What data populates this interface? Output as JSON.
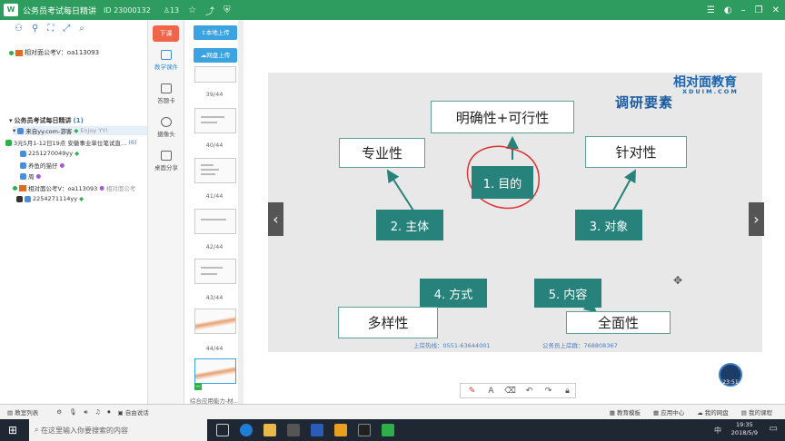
{
  "titlebar": {
    "logo": "W",
    "title": "公务员考试每日精讲",
    "room_id": "ID 23000132",
    "people": "13",
    "icons": [
      "minimize-icon",
      "restore-icon",
      "close-icon"
    ]
  },
  "left": {
    "user_row": "相对面公考V：oa113093",
    "channel_title": "公务员考试每日精讲",
    "channel_count": "(1)",
    "channel_items": [
      {
        "name": "来自yy.com-游客",
        "extra": "Enjoy YY!"
      },
      {
        "name": "3元5月1-12日19点 安徽事业单位笔试直…",
        "extra": "(6)"
      },
      {
        "name": "2251270049yy",
        "extra": ""
      },
      {
        "name": "养鱼的猫仔",
        "extra": ""
      },
      {
        "name": "周",
        "extra": ""
      },
      {
        "name": "相对面公考V：oa113093",
        "extra": "相对面公考"
      },
      {
        "name": "2254271114yy",
        "extra": ""
      }
    ]
  },
  "side": {
    "download": "下课",
    "items": [
      "教学课件",
      "答题卡",
      "摄像头",
      "桌面分享"
    ]
  },
  "thumbs": {
    "upload_local": "本地上传",
    "upload_cloud": "网盘上传",
    "pages": [
      "39/44",
      "40/44",
      "41/44",
      "42/44",
      "43/44",
      "44/44"
    ],
    "bottom_label": "综合应用能力-材…"
  },
  "slide": {
    "brand_cn": "相对面教育",
    "brand_en": "XDUIM.COM",
    "heading": "调研要素",
    "top_box": "明确性+可行性",
    "box_left": "专业性",
    "box_right": "针对性",
    "box_bl": "多样性",
    "box_br": "全面性",
    "center": "1. 目的",
    "g2": "2. 主体",
    "g3": "3. 对象",
    "g4": "4. 方式",
    "g5": "5. 内容",
    "foot_left": "上岸热线：0551-63644001",
    "foot_right": "公务员上岸群：768808367",
    "accent": "#26827a"
  },
  "clock": "23:51",
  "status": {
    "items": [
      "教室列表",
      "自由说话"
    ],
    "right": [
      "教育模板",
      "应用中心",
      "我的网盘",
      "我的课程"
    ]
  },
  "taskbar": {
    "search_placeholder": "在这里输入你要搜索的内容",
    "ime": "中",
    "time": "19:35",
    "date": "2018/5/9"
  }
}
